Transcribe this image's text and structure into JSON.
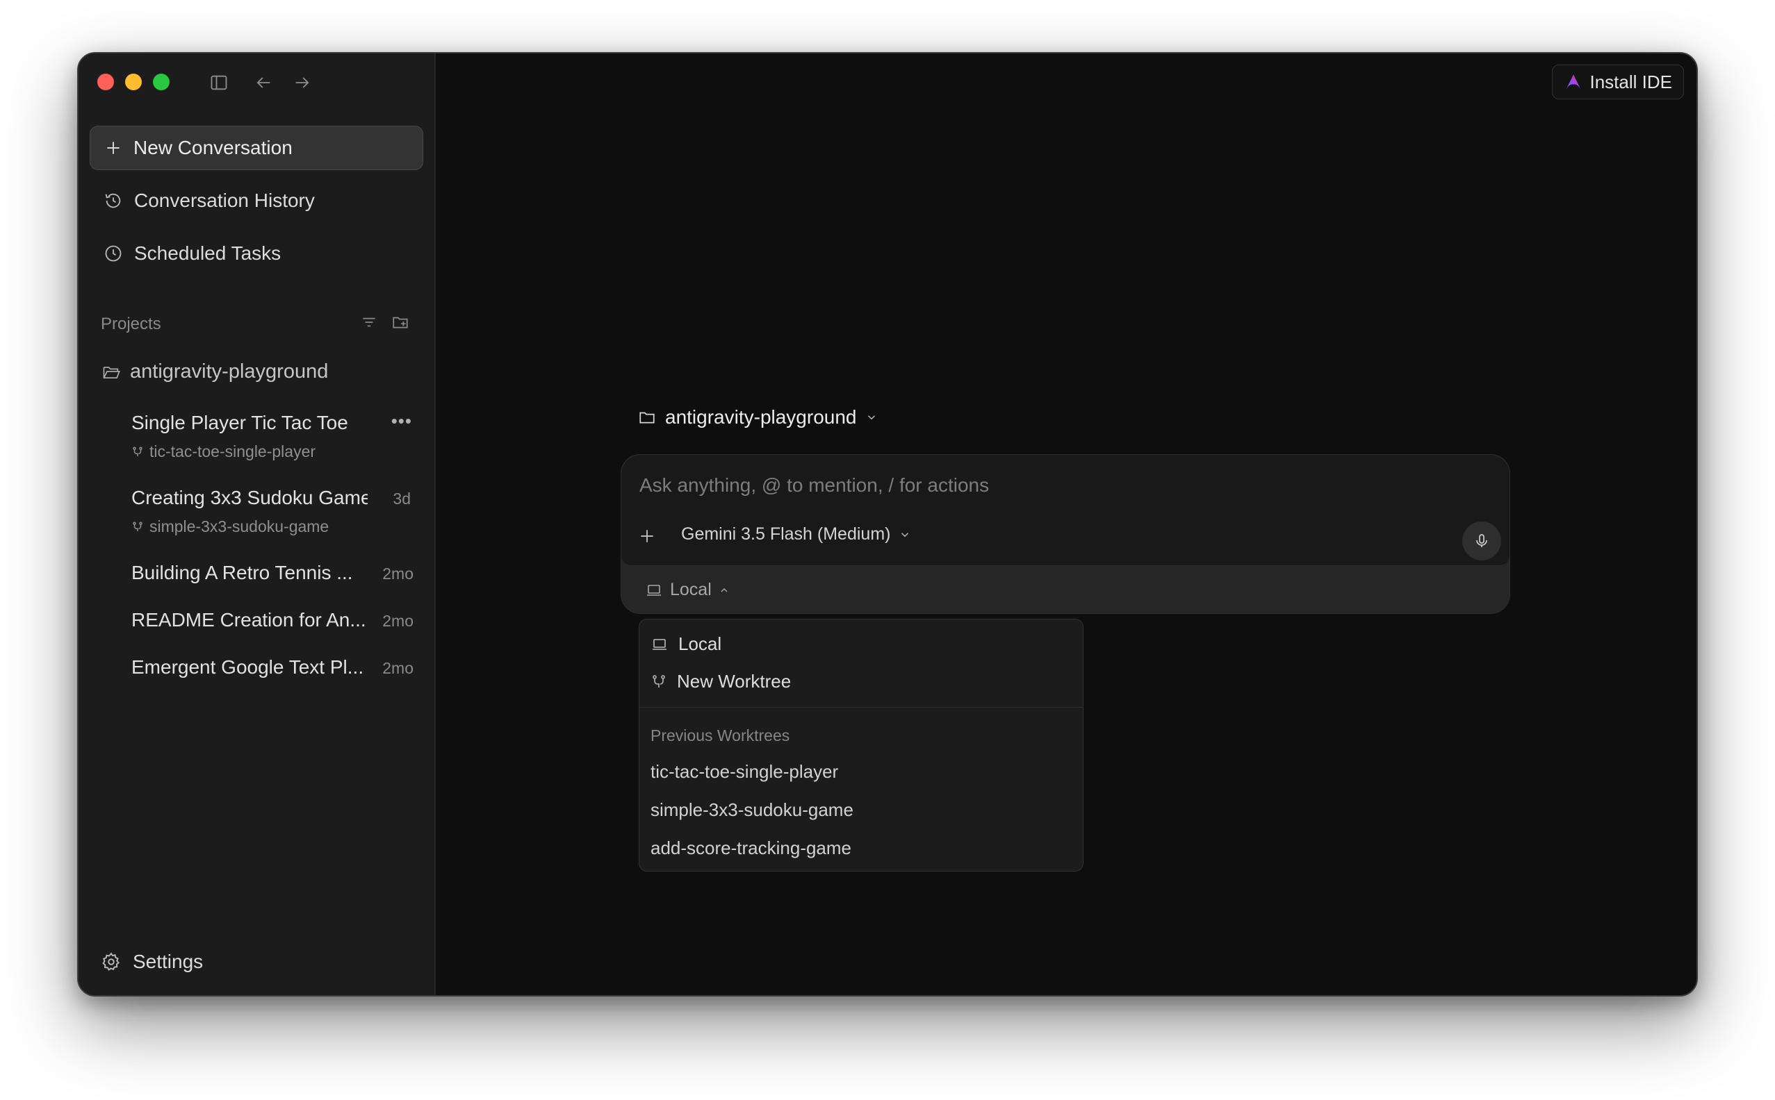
{
  "sidebar": {
    "new_conversation": "New Conversation",
    "conversation_history": "Conversation History",
    "scheduled_tasks": "Scheduled Tasks",
    "projects_label": "Projects",
    "project_name": "antigravity-playground",
    "conversations": [
      {
        "title": "Single Player Tic Tac Toe",
        "time": "",
        "branch": "tic-tac-toe-single-player"
      },
      {
        "title": "Creating 3x3 Sudoku Game",
        "time": "3d",
        "branch": "simple-3x3-sudoku-game"
      },
      {
        "title": "Building A Retro Tennis ...",
        "time": "2mo",
        "branch": ""
      },
      {
        "title": "README Creation for An...",
        "time": "2mo",
        "branch": ""
      },
      {
        "title": "Emergent Google Text Pl...",
        "time": "2mo",
        "branch": ""
      }
    ],
    "more_glyph": "•••",
    "settings": "Settings"
  },
  "header": {
    "install_ide": "Install IDE"
  },
  "composer": {
    "workspace": "antigravity-playground",
    "placeholder": "Ask anything, @ to mention, / for actions",
    "model": "Gemini 3.5 Flash (Medium)",
    "environment": "Local"
  },
  "dropdown": {
    "local": "Local",
    "new_worktree": "New Worktree",
    "previous_label": "Previous Worktrees",
    "worktrees": [
      "tic-tac-toe-single-player",
      "simple-3x3-sudoku-game",
      "add-score-tracking-game"
    ]
  },
  "colors": {
    "window_bg": "#0e0e0e",
    "sidebar_bg": "#1c1c1c",
    "traffic_red": "#fe5f57",
    "traffic_yellow": "#febc2e",
    "traffic_green": "#28c840"
  }
}
